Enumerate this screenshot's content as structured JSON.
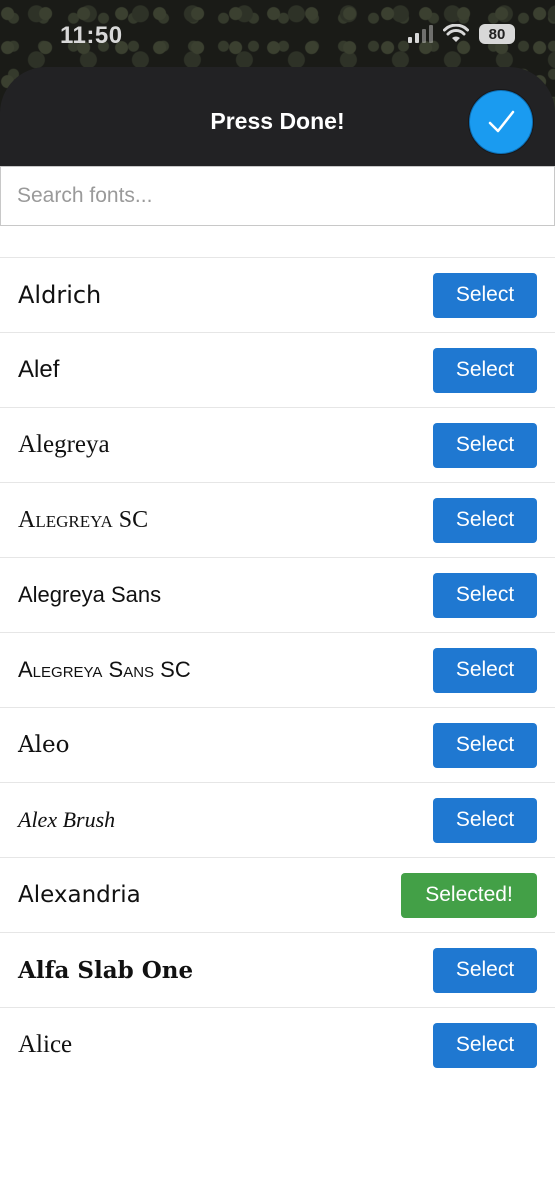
{
  "status_bar": {
    "time": "11:50",
    "battery": "80"
  },
  "header": {
    "title": "Press Done!"
  },
  "search": {
    "placeholder": "Search fonts...",
    "value": ""
  },
  "fonts": [
    {
      "name": "Aldrich",
      "button": "Select"
    },
    {
      "name": "Alef",
      "button": "Select"
    },
    {
      "name": "Alegreya",
      "button": "Select"
    },
    {
      "name": "Alegreya SC",
      "button": "Select"
    },
    {
      "name": "Alegreya Sans",
      "button": "Select"
    },
    {
      "name": "Alegreya Sans SC",
      "button": "Select"
    },
    {
      "name": "Aleo",
      "button": "Select"
    },
    {
      "name": "Alex Brush",
      "button": "Select"
    },
    {
      "name": "Alexandria",
      "button": "Selected!"
    },
    {
      "name": "Alfa Slab One",
      "button": "Select"
    },
    {
      "name": "Alice",
      "button": "Select"
    }
  ],
  "colors": {
    "select": "#1f78d1",
    "selected": "#43a047",
    "done": "#1a9bf0",
    "header": "#222224"
  },
  "icons": {
    "done": "checkmark-icon",
    "wifi": "wifi-icon",
    "signal": "cellular-signal-icon",
    "battery": "battery-icon"
  }
}
